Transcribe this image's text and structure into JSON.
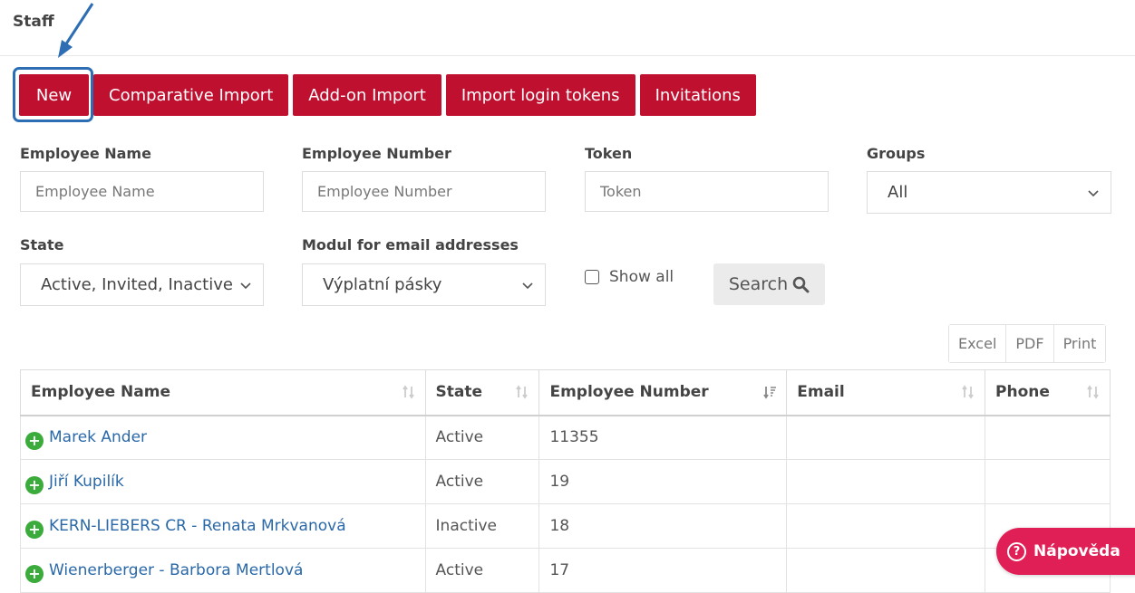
{
  "page": {
    "title": "Staff"
  },
  "toolbar": {
    "buttons": [
      "New",
      "Comparative Import",
      "Add-on Import",
      "Import login tokens",
      "Invitations"
    ]
  },
  "filters": {
    "employee_name": {
      "label": "Employee Name",
      "placeholder": "Employee Name",
      "value": ""
    },
    "employee_number": {
      "label": "Employee Number",
      "placeholder": "Employee Number",
      "value": ""
    },
    "token": {
      "label": "Token",
      "placeholder": "Token",
      "value": ""
    },
    "groups": {
      "label": "Groups",
      "value": "All"
    },
    "state": {
      "label": "State",
      "value": "Active, Invited, Inactive"
    },
    "modul": {
      "label": "Modul for email addresses",
      "value": "Výplatní pásky"
    },
    "show_all": {
      "label": "Show all",
      "checked": false
    },
    "search_label": "Search"
  },
  "export": {
    "buttons": [
      "Excel",
      "PDF",
      "Print"
    ]
  },
  "table": {
    "columns": [
      "Employee Name",
      "State",
      "Employee Number",
      "Email",
      "Phone"
    ],
    "rows": [
      {
        "name": "Marek Ander",
        "state": "Active",
        "number": "11355",
        "email": "",
        "phone": ""
      },
      {
        "name": "Jiří Kupilík",
        "state": "Active",
        "number": "19",
        "email": "",
        "phone": ""
      },
      {
        "name": "KERN-LIEBERS CR - Renata Mrkvanová",
        "state": "Inactive",
        "number": "18",
        "email": "",
        "phone": ""
      },
      {
        "name": "Wienerberger - Barbora Mertlová",
        "state": "Active",
        "number": "17",
        "email": "",
        "phone": ""
      }
    ]
  },
  "help": {
    "label": "Nápověda"
  },
  "colors": {
    "primary_red": "#c0102f",
    "link_blue": "#2a68a8",
    "help_pink": "#e01f56",
    "highlight_blue": "#2d6db3"
  }
}
